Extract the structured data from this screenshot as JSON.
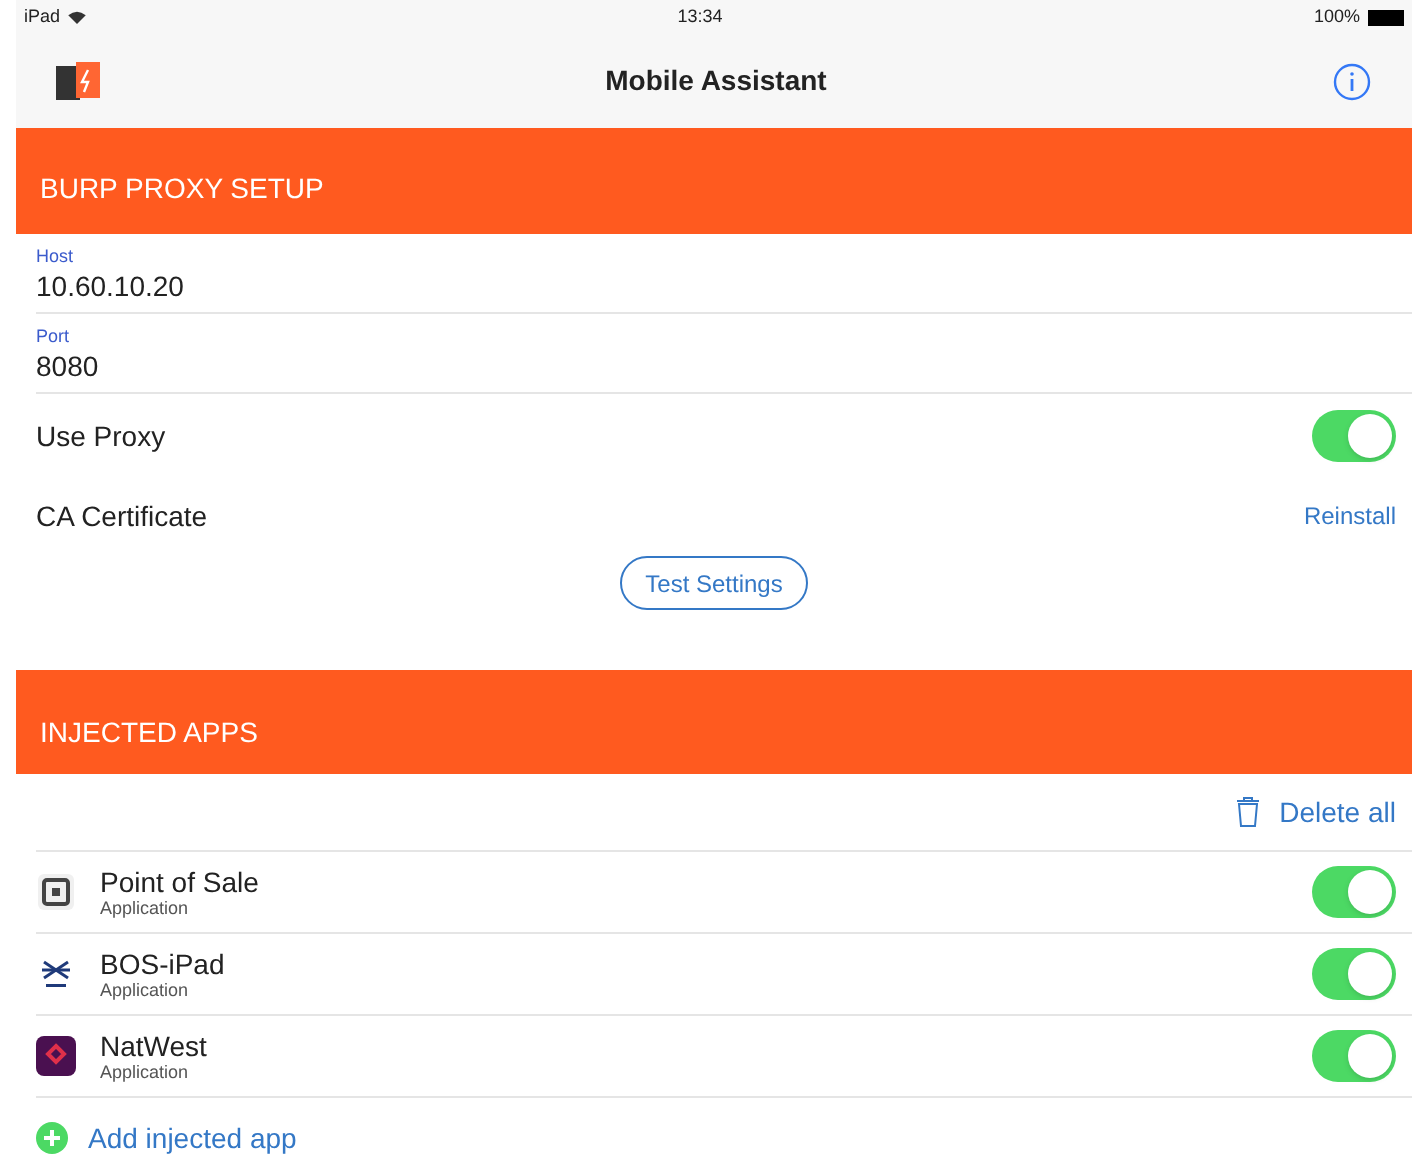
{
  "status_bar": {
    "device": "iPad",
    "time": "13:34",
    "battery": "100%"
  },
  "nav": {
    "title": "Mobile Assistant"
  },
  "proxy_section": {
    "header": "BURP PROXY SETUP",
    "fields": [
      {
        "label": "Host",
        "value": "10.60.10.20"
      },
      {
        "label": "Port",
        "value": "8080"
      }
    ],
    "use_proxy": {
      "label": "Use Proxy",
      "on": true
    },
    "certificate": {
      "label": "CA Certificate",
      "action": "Reinstall"
    },
    "test_button": "Test Settings"
  },
  "apps_section": {
    "header": "INJECTED APPS",
    "delete_all": "Delete all",
    "apps": [
      {
        "kind": "square",
        "name": "Point of Sale",
        "type": "Application",
        "on": true
      },
      {
        "kind": "snowflake",
        "name": "BOS-iPad",
        "type": "Application",
        "on": true
      },
      {
        "kind": "bank",
        "name": "NatWest",
        "type": "Application",
        "on": true
      }
    ],
    "add_button": "Add injected app"
  }
}
